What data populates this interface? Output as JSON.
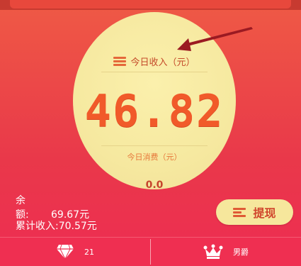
{
  "income": {
    "label": "今日收入（元）",
    "value": "46.82",
    "icon": "coin-stack-icon"
  },
  "spend": {
    "label": "今日消费（元）",
    "value": "0.0"
  },
  "balance": {
    "label": "余　　额:",
    "value": "69.67元"
  },
  "total_income": {
    "label": "累计收入:",
    "value": "70.57元"
  },
  "withdraw": {
    "label": "提现",
    "icon": "coin-stack-up-icon"
  },
  "bottom_nav": {
    "diamond": {
      "icon": "diamond-icon",
      "count": "21"
    },
    "rank": {
      "icon": "crown-icon",
      "label": "男爵"
    }
  },
  "colors": {
    "accent": "#ef2f51",
    "circle": "#f7eaa2",
    "digits": "#f15a2a"
  }
}
